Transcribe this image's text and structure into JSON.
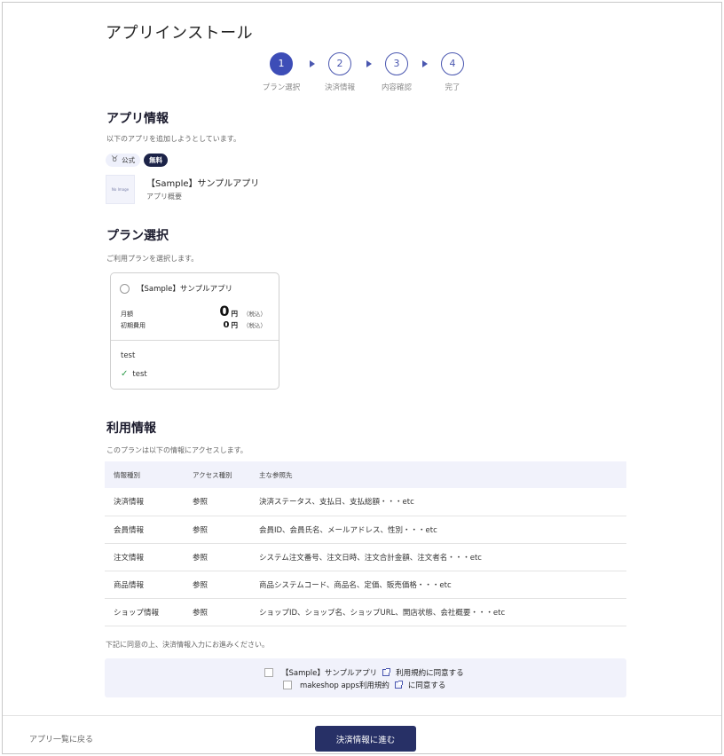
{
  "page_title": "アプリインストール",
  "steps": [
    {
      "number": "1",
      "label": "プラン選択",
      "active": true
    },
    {
      "number": "2",
      "label": "決済情報",
      "active": false
    },
    {
      "number": "3",
      "label": "内容確認",
      "active": false
    },
    {
      "number": "4",
      "label": "完了",
      "active": false
    }
  ],
  "app_info": {
    "title": "アプリ情報",
    "note": "以下のアプリを追加しようとしています。",
    "badge_official": "公式",
    "badge_free": "無料",
    "thumb_text": "No Image",
    "app_name": "【Sample】サンプルアプリ",
    "app_desc": "アプリ概要"
  },
  "plan_select": {
    "title": "プラン選択",
    "note": "ご利用プランを選択します。",
    "plan": {
      "name": "【Sample】サンプルアプリ",
      "monthly_label": "月額",
      "monthly_value": "0",
      "initial_label": "初期費用",
      "initial_value": "0",
      "unit": "円",
      "tax_note": "（税込）",
      "feature_title": "test",
      "feature_item": "test"
    }
  },
  "usage_info": {
    "title": "利用情報",
    "note": "このプランは以下の情報にアクセスします。",
    "headers": [
      "情報種別",
      "アクセス種別",
      "主な参照先"
    ],
    "rows": [
      [
        "決済情報",
        "参照",
        "決済ステータス、支払日、支払総額・・・etc"
      ],
      [
        "会員情報",
        "参照",
        "会員ID、会員氏名、メールアドレス、性別・・・etc"
      ],
      [
        "注文情報",
        "参照",
        "システム注文番号、注文日時、注文合計金額、注文者名・・・etc"
      ],
      [
        "商品情報",
        "参照",
        "商品システムコード、商品名、定価、販売価格・・・etc"
      ],
      [
        "ショップ情報",
        "参照",
        "ショップID、ショップ名、ショップURL、開店状態、会社概要・・・etc"
      ]
    ]
  },
  "agreement": {
    "note": "下記に同意の上、決済情報入力にお進みください。",
    "app_terms_name": "【Sample】サンプルアプリ",
    "app_terms_suffix": "利用規約に同意する",
    "platform_terms_name": "makeshop apps利用規約",
    "platform_terms_suffix": "に同意する"
  },
  "footer": {
    "back_label": "アプリ一覧に戻る",
    "next_label": "決済情報に進む"
  },
  "colors": {
    "accent": "#3d4db7",
    "button": "#273066",
    "table_header": "#f1f2fb",
    "check": "#2e9a4a"
  }
}
